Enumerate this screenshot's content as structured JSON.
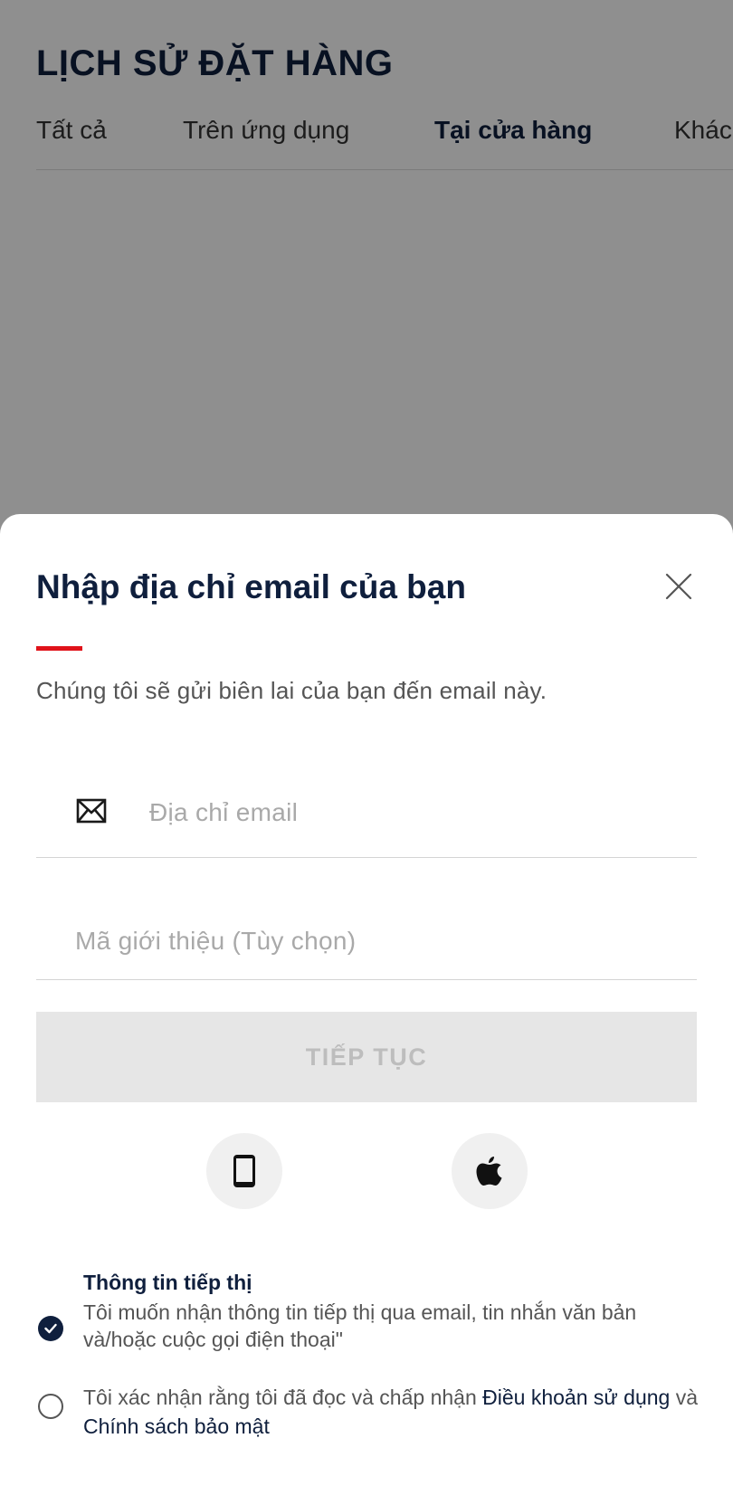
{
  "background": {
    "title": "LỊCH SỬ ĐẶT HÀNG",
    "tabs": [
      {
        "label": "Tất cả"
      },
      {
        "label": "Trên ứng dụng"
      },
      {
        "label": "Tại cửa hàng"
      },
      {
        "label": "Khác"
      }
    ],
    "active_tab": "Tại cửa hàng"
  },
  "sheet": {
    "title": "Nhập địa chỉ email của bạn",
    "subtitle": "Chúng tôi sẽ gửi biên lai của bạn đến email này.",
    "email_placeholder": "Địa chỉ email",
    "referral_placeholder": "Mã giới thiệu (Tùy chọn)",
    "continue_label": "TIẾP TỤC",
    "social_buttons": [
      "phone-icon",
      "apple-icon"
    ],
    "marketing": {
      "title": "Thông tin tiếp thị",
      "text": "Tôi muốn nhận thông tin tiếp thị qua email, tin nhắn văn bản và/hoặc cuộc gọi điện thoại\"",
      "checked": true
    },
    "terms": {
      "prefix": "Tôi xác nhận rằng tôi đã đọc và chấp nhận ",
      "terms_link": "Điều khoản sử dụng",
      "conjunction": " và ",
      "privacy_link": "Chính sách bảo mật",
      "checked": false
    }
  },
  "colors": {
    "navy": "#0f1f3d",
    "accent_red": "#e0121a",
    "disabled_button": "#e6e6e6"
  }
}
